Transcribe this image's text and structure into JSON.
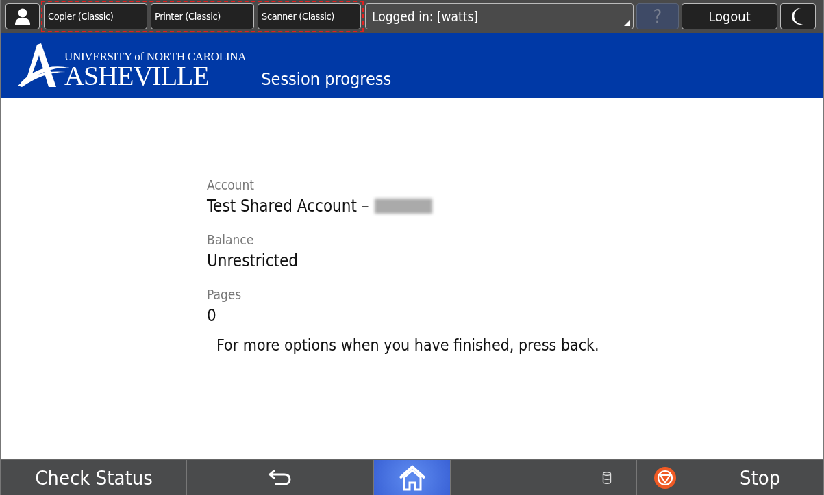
{
  "top_bar": {
    "modes": [
      {
        "label": "Copier (Classic)"
      },
      {
        "label": "Printer (Classic)"
      },
      {
        "label": "Scanner (Classic)"
      }
    ],
    "login": {
      "label": "Logged in: [watts]"
    },
    "help": {
      "label": "?",
      "disabled": true
    },
    "logout": {
      "label": "Logout"
    }
  },
  "header": {
    "logo_top": "UNIVERSITY of NORTH CAROLINA",
    "logo_main": "ASHEVILLE",
    "title": "Session progress"
  },
  "fields": [
    {
      "label": "Account",
      "value": "Test Shared Account –",
      "redacted": true
    },
    {
      "label": "Balance",
      "value": "Unrestricted",
      "redacted": false
    },
    {
      "label": "Pages",
      "value": "0",
      "redacted": false
    }
  ],
  "hint": "For more options when you have finished, press back.",
  "bottom_bar": {
    "check_status": "Check Status",
    "home_selected": true,
    "stop": "Stop"
  }
}
